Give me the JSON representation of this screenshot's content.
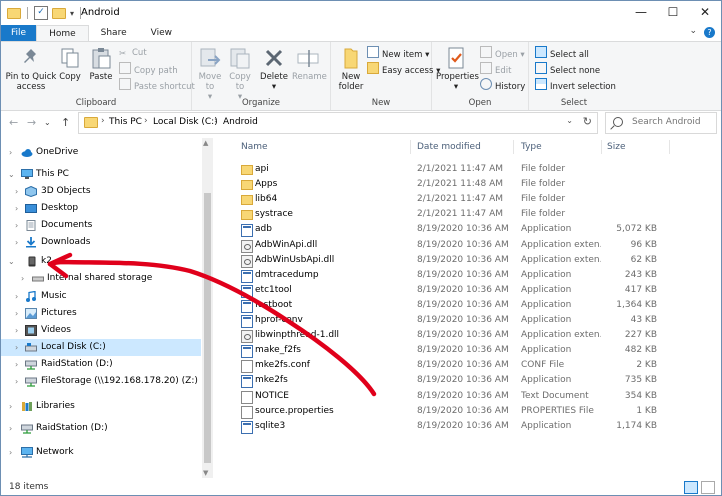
{
  "window": {
    "title": "Android",
    "controls": [
      "minimize",
      "maximize",
      "close"
    ]
  },
  "ribbon_tabs": [
    {
      "label": "File"
    },
    {
      "label": "Home"
    },
    {
      "label": "Share"
    },
    {
      "label": "View"
    }
  ],
  "ribbon": {
    "clipboard": {
      "label": "Clipboard",
      "pin_label": "Pin to Quick access",
      "copy_label": "Copy",
      "paste_label": "Paste",
      "cut_label": "Cut",
      "copy_path_label": "Copy path",
      "paste_shortcut_label": "Paste shortcut"
    },
    "organize": {
      "label": "Organize",
      "move_to_label": "Move to",
      "copy_to_label": "Copy to",
      "delete_label": "Delete",
      "rename_label": "Rename"
    },
    "new": {
      "label": "New",
      "new_folder_label": "New folder",
      "new_item_label": "New item",
      "easy_access_label": "Easy access"
    },
    "open": {
      "label": "Open",
      "properties_label": "Properties",
      "open_label": "Open",
      "edit_label": "Edit",
      "history_label": "History"
    },
    "select": {
      "label": "Select",
      "select_all_label": "Select all",
      "select_none_label": "Select none",
      "invert_selection_label": "Invert selection"
    }
  },
  "address": {
    "crumbs": [
      "This PC",
      "Local Disk (C:)",
      "Android"
    ]
  },
  "search": {
    "placeholder": "Search Android"
  },
  "nav": {
    "items": [
      {
        "label": "OneDrive",
        "icon": "cloud-icon"
      },
      {
        "label": "This PC",
        "icon": "computer-icon"
      },
      {
        "label": "3D Objects",
        "icon": "cube-icon"
      },
      {
        "label": "Desktop",
        "icon": "desktop-icon"
      },
      {
        "label": "Documents",
        "icon": "documents-icon"
      },
      {
        "label": "Downloads",
        "icon": "downloads-icon"
      },
      {
        "label": "k2",
        "icon": "phone-icon"
      },
      {
        "label": "Internal shared storage",
        "icon": "storage-icon"
      },
      {
        "label": "Music",
        "icon": "music-icon"
      },
      {
        "label": "Pictures",
        "icon": "pictures-icon"
      },
      {
        "label": "Videos",
        "icon": "videos-icon"
      },
      {
        "label": "Local Disk (C:)",
        "icon": "drive-icon"
      },
      {
        "label": "RaidStation (D:)",
        "icon": "network-drive-icon"
      },
      {
        "label": "FileStorage (\\\\192.168.178.20) (Z:)",
        "icon": "network-drive-icon"
      },
      {
        "label": "Libraries",
        "icon": "libraries-icon"
      },
      {
        "label": "RaidStation (D:)",
        "icon": "network-drive-icon"
      },
      {
        "label": "Network",
        "icon": "network-icon"
      }
    ]
  },
  "columns": {
    "name": "Name",
    "date": "Date modified",
    "type": "Type",
    "size": "Size"
  },
  "files": [
    {
      "name": "api",
      "date": "2/1/2021 11:47 AM",
      "type": "File folder",
      "size": "",
      "kind": "folder"
    },
    {
      "name": "Apps",
      "date": "2/1/2021 11:48 AM",
      "type": "File folder",
      "size": "",
      "kind": "folder"
    },
    {
      "name": "lib64",
      "date": "2/1/2021 11:47 AM",
      "type": "File folder",
      "size": "",
      "kind": "folder"
    },
    {
      "name": "systrace",
      "date": "2/1/2021 11:47 AM",
      "type": "File folder",
      "size": "",
      "kind": "folder"
    },
    {
      "name": "adb",
      "date": "8/19/2020 10:36 AM",
      "type": "Application",
      "size": "5,072 KB",
      "kind": "app"
    },
    {
      "name": "AdbWinApi.dll",
      "date": "8/19/2020 10:36 AM",
      "type": "Application exten...",
      "size": "96 KB",
      "kind": "dll"
    },
    {
      "name": "AdbWinUsbApi.dll",
      "date": "8/19/2020 10:36 AM",
      "type": "Application exten...",
      "size": "62 KB",
      "kind": "dll"
    },
    {
      "name": "dmtracedump",
      "date": "8/19/2020 10:36 AM",
      "type": "Application",
      "size": "243 KB",
      "kind": "app"
    },
    {
      "name": "etc1tool",
      "date": "8/19/2020 10:36 AM",
      "type": "Application",
      "size": "417 KB",
      "kind": "app"
    },
    {
      "name": "fastboot",
      "date": "8/19/2020 10:36 AM",
      "type": "Application",
      "size": "1,364 KB",
      "kind": "app"
    },
    {
      "name": "hprof-conv",
      "date": "8/19/2020 10:36 AM",
      "type": "Application",
      "size": "43 KB",
      "kind": "app"
    },
    {
      "name": "libwinpthread-1.dll",
      "date": "8/19/2020 10:36 AM",
      "type": "Application exten...",
      "size": "227 KB",
      "kind": "dll"
    },
    {
      "name": "make_f2fs",
      "date": "8/19/2020 10:36 AM",
      "type": "Application",
      "size": "482 KB",
      "kind": "app"
    },
    {
      "name": "mke2fs.conf",
      "date": "8/19/2020 10:36 AM",
      "type": "CONF File",
      "size": "2 KB",
      "kind": "doc"
    },
    {
      "name": "mke2fs",
      "date": "8/19/2020 10:36 AM",
      "type": "Application",
      "size": "735 KB",
      "kind": "app"
    },
    {
      "name": "NOTICE",
      "date": "8/19/2020 10:36 AM",
      "type": "Text Document",
      "size": "354 KB",
      "kind": "doc"
    },
    {
      "name": "source.properties",
      "date": "8/19/2020 10:36 AM",
      "type": "PROPERTIES File",
      "size": "1 KB",
      "kind": "doc"
    },
    {
      "name": "sqlite3",
      "date": "8/19/2020 10:36 AM",
      "type": "Application",
      "size": "1,174 KB",
      "kind": "app"
    }
  ],
  "status": {
    "item_count": "18 items"
  },
  "colors": {
    "accent": "#1979ca",
    "selection": "#cce8ff",
    "annotation": "#e0001b"
  }
}
